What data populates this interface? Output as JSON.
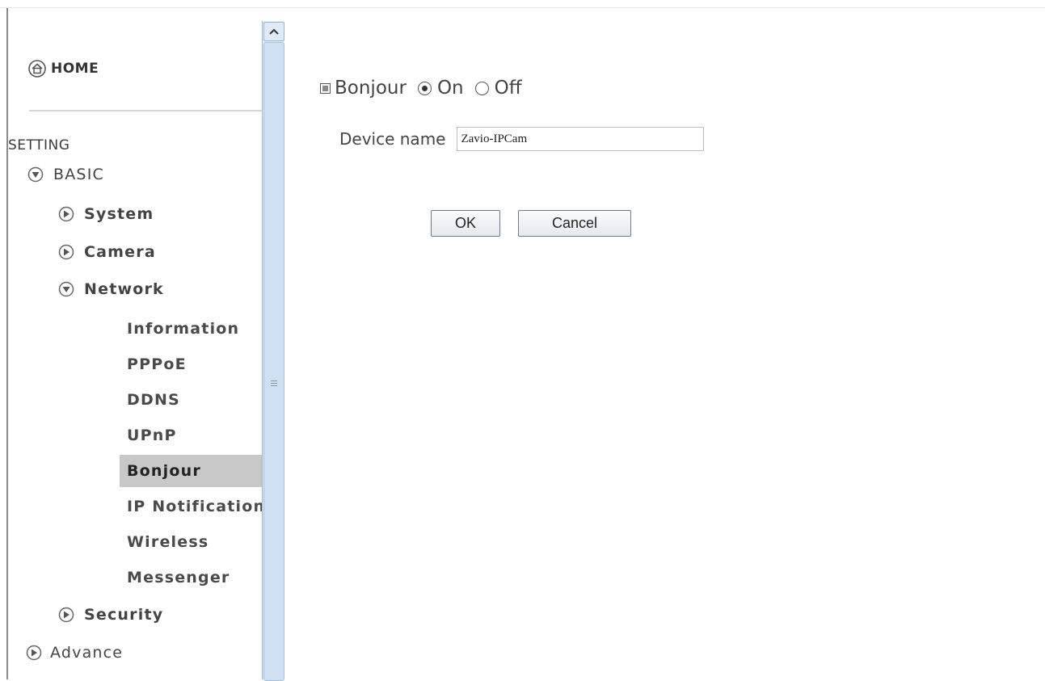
{
  "sidebar": {
    "home_label": "HOME",
    "section_title": "SETTING",
    "basic": "BASIC",
    "system": "System",
    "camera": "Camera",
    "network": "Network",
    "network_items": [
      "Information",
      "PPPoE",
      "DDNS",
      "UPnP",
      "Bonjour",
      "IP Notification",
      "Wireless",
      "Messenger"
    ],
    "selected_item": "Bonjour",
    "security": "Security",
    "advance": "Advance"
  },
  "form": {
    "bonjour_label": "Bonjour",
    "radio_on": "On",
    "radio_off": "Off",
    "selected_option": "On",
    "device_name_label": "Device name",
    "device_name_value": "Zavio-IPCam",
    "ok_label": "OK",
    "cancel_label": "Cancel"
  },
  "colors": {
    "selected_bg": "#c8c8c8",
    "scrollbar": "#cfe0f2"
  }
}
